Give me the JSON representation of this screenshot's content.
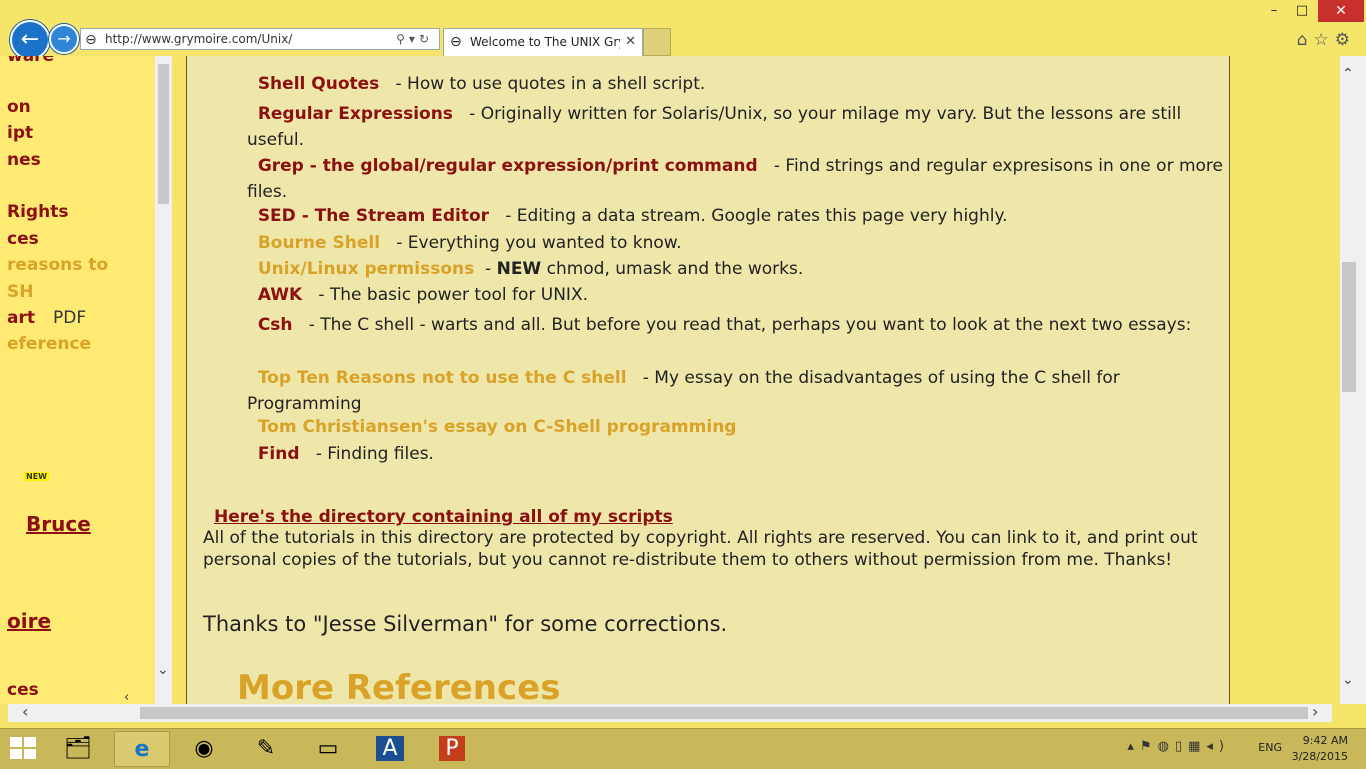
{
  "browser": {
    "url": "http://www.grymoire.com/Unix/",
    "tab_title": "Welcome to The UNIX Gry...",
    "window": {
      "minimize": "–",
      "maximize": "□",
      "close": "✕"
    }
  },
  "left_frame": {
    "items": [
      {
        "text": "ware",
        "style": "dark"
      },
      {
        "text": "on",
        "style": "dark"
      },
      {
        "text": "ipt",
        "style": "dark"
      },
      {
        "text": "nes",
        "style": "dark"
      },
      {
        "text": "Rights",
        "style": "dark"
      },
      {
        "text": "ces",
        "style": "dark"
      },
      {
        "text": "reasons to",
        "style": "gold"
      },
      {
        "text": "SH",
        "style": "gold"
      },
      {
        "text": "art",
        "style": "dark"
      },
      {
        "text": "PDF",
        "style": "plain"
      },
      {
        "text": "eference",
        "style": "gold"
      }
    ],
    "new_badge": "NEW",
    "bruce": "Bruce",
    "moire": "oire",
    "ces_bottom": "ces"
  },
  "main": {
    "entries": [
      {
        "link": "Shell Quotes",
        "style": "dark",
        "desc": " - How to use quotes in a shell script."
      },
      {
        "link": "Regular Expressions",
        "style": "dark",
        "desc": " - Originally written for Solaris/Unix, so your milage my vary. But the lessons are still useful."
      },
      {
        "link": "Grep - the global/regular expression/print command",
        "style": "dark",
        "desc": " - Find strings and regular expresisons in one or more files."
      },
      {
        "link": "SED - The Stream Editor",
        "style": "dark",
        "desc": " - Editing a data stream. Google rates this page very highly."
      },
      {
        "link": "Bourne Shell",
        "style": "gold",
        "desc": " - Everything you wanted to know."
      },
      {
        "link": "Unix/Linux permissons",
        "style": "gold",
        "desc_strong": "NEW",
        "desc": " chmod, umask and the works."
      },
      {
        "link": "AWK",
        "style": "dark",
        "desc": " - The basic power tool for UNIX."
      },
      {
        "link": "Csh",
        "style": "dark",
        "desc": " - The C shell - warts and all. But before you read that, perhaps you want to look at the next two essays:"
      },
      {
        "link": "Top Ten Reasons not to use the C shell",
        "style": "gold",
        "desc": " - My essay on the disadvantages of using the C shell for Programming"
      },
      {
        "link": "Tom Christiansen's essay on C-Shell programming",
        "style": "gold",
        "desc": ""
      },
      {
        "link": "Find",
        "style": "dark",
        "desc": " - Finding files."
      }
    ],
    "directory_link": "Here's the directory containing all of my scripts",
    "copyright": "All of the tutorials in this directory are protected by copyright. All rights are reserved. You can link to it, and print out personal copies of the tutorials, but you cannot re-distribute them to others without permission from me. Thanks!",
    "thanks": "Thanks to \"Jesse Silverman\" for some corrections.",
    "more_references": "More References"
  },
  "taskbar": {
    "lang": "ENG",
    "time": "9:42 AM",
    "date": "3/28/2015"
  }
}
